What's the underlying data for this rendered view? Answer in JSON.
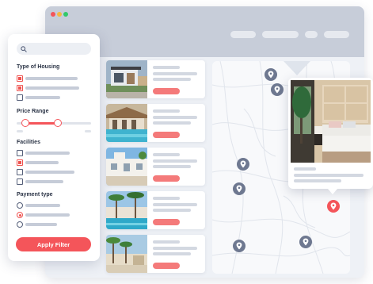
{
  "window": {
    "traffic_lights": [
      "#f4555a",
      "#f5b940",
      "#33c96b"
    ]
  },
  "filter": {
    "search": {
      "placeholder": ""
    },
    "type_of_housing": {
      "title": "Type of Housing",
      "options": [
        {
          "checked": true
        },
        {
          "checked": true
        },
        {
          "checked": false
        }
      ]
    },
    "price_range": {
      "title": "Price Range",
      "low": 0.12,
      "high": 0.55
    },
    "facilities": {
      "title": "Facilities",
      "options": [
        {
          "checked": false
        },
        {
          "checked": true
        },
        {
          "checked": false
        },
        {
          "checked": false
        }
      ]
    },
    "payment_type": {
      "title": "Payment type",
      "options": [
        {
          "selected": false
        },
        {
          "selected": true
        },
        {
          "selected": false
        }
      ]
    },
    "apply_label": "Apply Filter"
  },
  "listings": [
    {
      "thumbnail": "modern-house-photo"
    },
    {
      "thumbnail": "pool-villa-photo"
    },
    {
      "thumbnail": "white-villa-photo"
    },
    {
      "thumbnail": "palm-resort-photo"
    },
    {
      "thumbnail": "tropical-resort-photo"
    }
  ],
  "map": {
    "pins": [
      "location-pin-icon",
      "location-pin-icon",
      "location-pin-icon",
      "location-pin-icon",
      "location-pin-icon",
      "location-pin-icon",
      "location-pin-icon"
    ],
    "selected_pin": "location-pin-icon"
  },
  "preview": {
    "photo": "bedroom-photo"
  },
  "colors": {
    "accent": "#f4555a",
    "pin": "#6e7890",
    "panel": "#ffffff"
  }
}
